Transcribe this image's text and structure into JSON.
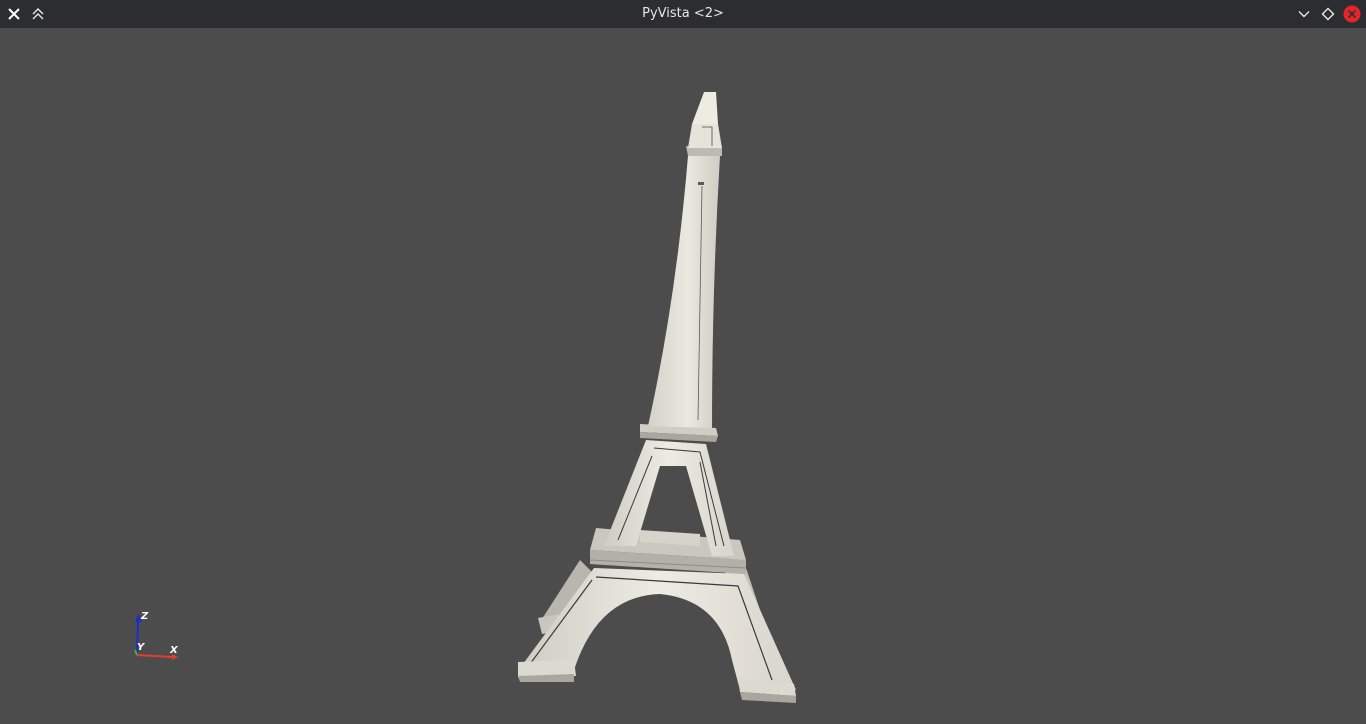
{
  "window": {
    "title": "PyVista <2>"
  },
  "titlebar": {
    "left_buttons": [
      "close-x-icon",
      "keep-above-icon"
    ],
    "right_buttons": [
      "minimize-icon",
      "maximize-icon",
      "close-icon"
    ],
    "close_color": "#e0262a"
  },
  "viewport": {
    "background": "#4c4c4c",
    "model": "eiffel-tower-mesh",
    "model_color": "#ebe8df"
  },
  "axes_widget": {
    "x_label": "X",
    "y_label": "Y",
    "z_label": "Z",
    "x_color": "#e0402a",
    "y_color": "#30c030",
    "z_color": "#1c2cc8"
  }
}
